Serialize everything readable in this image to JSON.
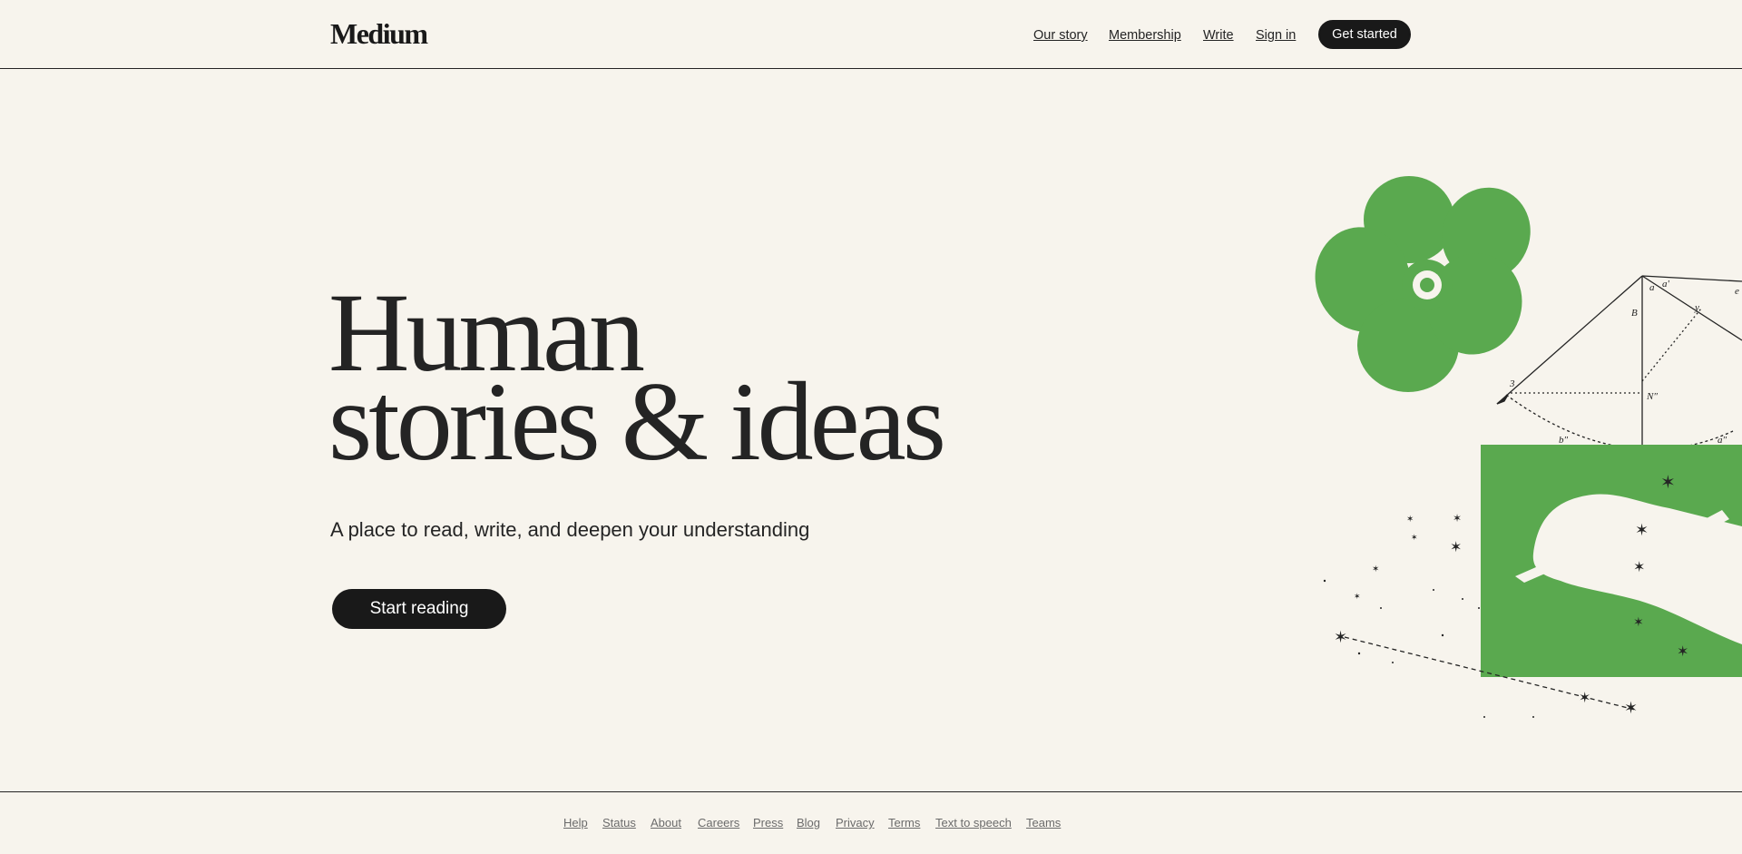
{
  "header": {
    "logo": "Medium",
    "nav": {
      "our_story": "Our story",
      "membership": "Membership",
      "write": "Write",
      "sign_in": "Sign in"
    },
    "get_started": "Get started"
  },
  "hero": {
    "title_line1": "Human",
    "title_line2": "stories & ideas",
    "subtitle": "A place to read, write, and deepen your understanding",
    "cta": "Start reading"
  },
  "illustration": {
    "accent_color": "#5aa94f",
    "ink_color": "#242424",
    "geometry_labels": [
      "B",
      "N″",
      "E",
      "a″",
      "b″",
      "3",
      "a",
      "a'",
      "y",
      "e"
    ]
  },
  "footer": {
    "help": "Help",
    "status": "Status",
    "about": "About",
    "careers": "Careers",
    "press": "Press",
    "blog": "Blog",
    "privacy": "Privacy",
    "terms": "Terms",
    "text_to_speech": "Text to speech",
    "teams": "Teams"
  },
  "colors": {
    "background": "#f7f4ed",
    "text": "#242424",
    "button": "#191919",
    "footer_text": "#6b6b6b"
  }
}
